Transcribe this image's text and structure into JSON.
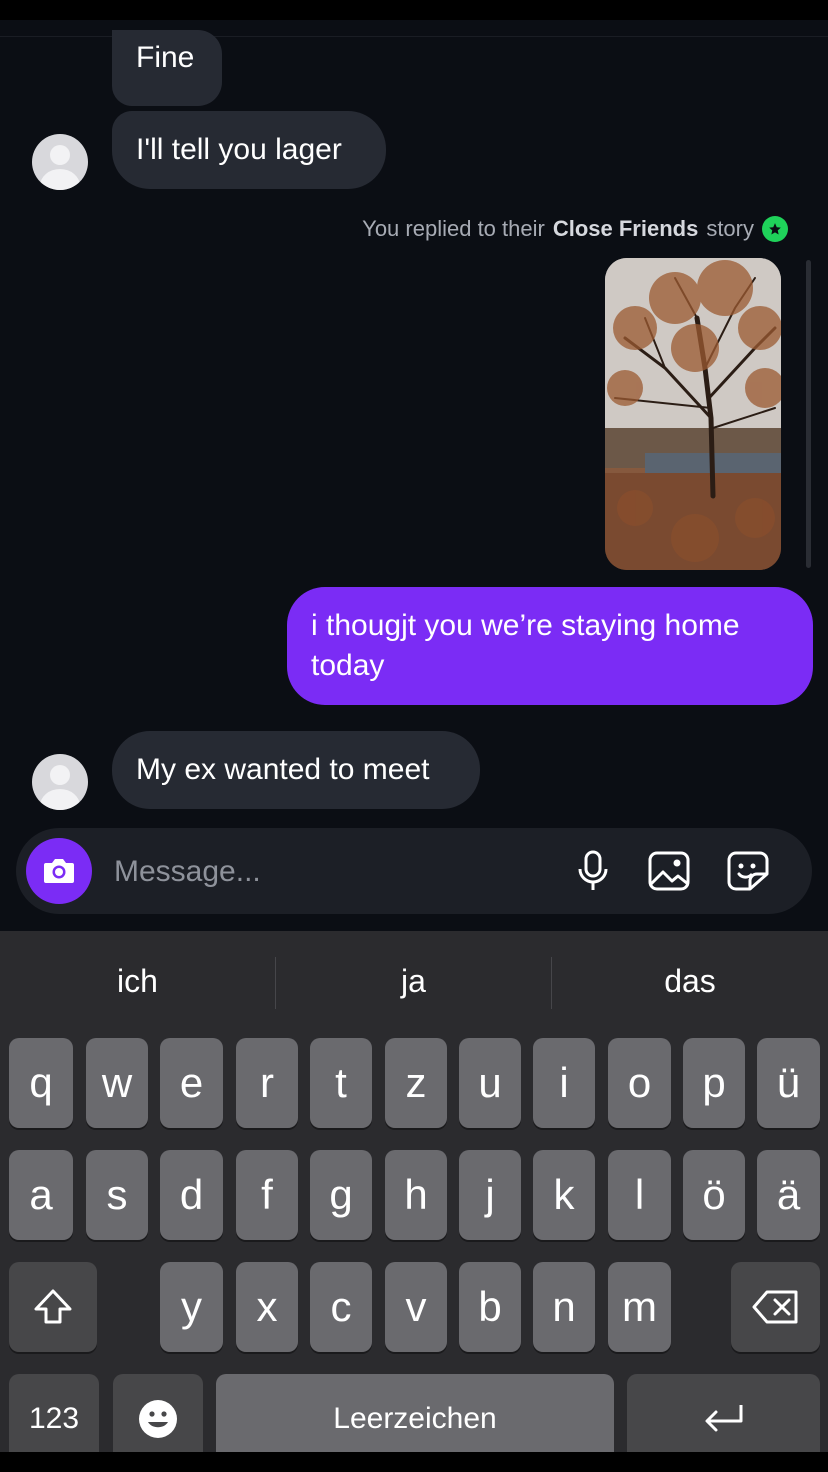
{
  "messages": {
    "fine": "Fine",
    "later": "I'll tell you lager",
    "story_reply_prefix": "You replied to their",
    "story_reply_bold": "Close Friends",
    "story_reply_suffix": "story",
    "mine": "i thougjt you we’re staying home today",
    "ex": "My ex wanted to meet"
  },
  "composer": {
    "placeholder": "Message..."
  },
  "keyboard": {
    "suggestions": [
      "ich",
      "ja",
      "das"
    ],
    "row1": [
      "q",
      "w",
      "e",
      "r",
      "t",
      "z",
      "u",
      "i",
      "o",
      "p",
      "ü"
    ],
    "row2": [
      "a",
      "s",
      "d",
      "f",
      "g",
      "h",
      "j",
      "k",
      "l",
      "ö",
      "ä"
    ],
    "row3": [
      "y",
      "x",
      "c",
      "v",
      "b",
      "n",
      "m"
    ],
    "numbers_label": "123",
    "space_label": "Leerzeichen"
  },
  "colors": {
    "accent": "#7b2cf5",
    "background": "#0b0e14",
    "bubble_incoming": "#262a33",
    "close_friends_star": "#1fd25a"
  }
}
